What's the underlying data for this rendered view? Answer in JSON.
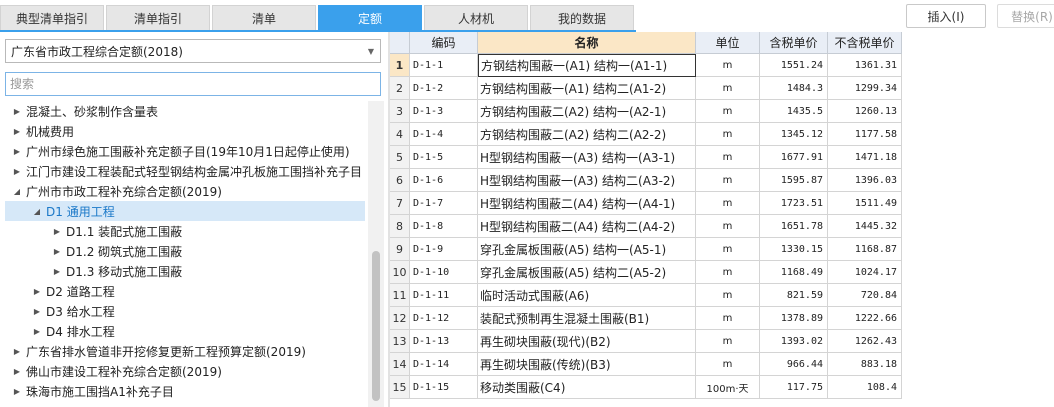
{
  "tabs": [
    {
      "label": "典型清单指引",
      "active": false
    },
    {
      "label": "清单指引",
      "active": false
    },
    {
      "label": "清单",
      "active": false
    },
    {
      "label": "定额",
      "active": true
    },
    {
      "label": "人材机",
      "active": false
    },
    {
      "label": "我的数据",
      "active": false
    }
  ],
  "buttons": {
    "insert": "插入(I)",
    "replace": "替换(R)"
  },
  "left": {
    "selected_library": "广东省市政工程综合定额(2018)",
    "search_placeholder": "搜索",
    "tree": [
      {
        "label": "混凝土、砂浆制作含量表",
        "level": 0,
        "expanded": false,
        "selected": false
      },
      {
        "label": "机械费用",
        "level": 0,
        "expanded": false,
        "selected": false
      },
      {
        "label": "广州市绿色施工围蔽补充定额子目(19年10月1日起停止使用)",
        "level": 0,
        "expanded": false,
        "selected": false
      },
      {
        "label": "江门市建设工程装配式轻型钢结构金属冲孔板施工围挡补充子目",
        "level": 0,
        "expanded": false,
        "selected": false
      },
      {
        "label": "广州市市政工程补充综合定额(2019)",
        "level": 0,
        "expanded": true,
        "selected": false
      },
      {
        "label": "D1 通用工程",
        "level": 1,
        "expanded": true,
        "selected": true
      },
      {
        "label": "D1.1 装配式施工围蔽",
        "level": 2,
        "expanded": false,
        "selected": false
      },
      {
        "label": "D1.2 砌筑式施工围蔽",
        "level": 2,
        "expanded": false,
        "selected": false
      },
      {
        "label": "D1.3 移动式施工围蔽",
        "level": 2,
        "expanded": false,
        "selected": false
      },
      {
        "label": "D2 道路工程",
        "level": 1,
        "expanded": false,
        "selected": false
      },
      {
        "label": "D3 给水工程",
        "level": 1,
        "expanded": false,
        "selected": false
      },
      {
        "label": "D4 排水工程",
        "level": 1,
        "expanded": false,
        "selected": false
      },
      {
        "label": "广东省排水管道非开挖修复更新工程预算定额(2019)",
        "level": 0,
        "expanded": false,
        "selected": false
      },
      {
        "label": "佛山市建设工程补充综合定额(2019)",
        "level": 0,
        "expanded": false,
        "selected": false
      },
      {
        "label": "珠海市施工围挡A1补充子目",
        "level": 0,
        "expanded": false,
        "selected": false
      }
    ]
  },
  "table": {
    "columns": [
      "",
      "编码",
      "名称",
      "单位",
      "含税单价",
      "不含税单价"
    ],
    "rows": [
      {
        "n": "1",
        "code": "D-1-1",
        "name": "方钢结构围蔽一(A1) 结构一(A1-1)",
        "unit": "m",
        "price_tax": "1551.24",
        "price_notax": "1361.31"
      },
      {
        "n": "2",
        "code": "D-1-2",
        "name": "方钢结构围蔽一(A1) 结构二(A1-2)",
        "unit": "m",
        "price_tax": "1484.3",
        "price_notax": "1299.34"
      },
      {
        "n": "3",
        "code": "D-1-3",
        "name": "方钢结构围蔽二(A2) 结构一(A2-1)",
        "unit": "m",
        "price_tax": "1435.5",
        "price_notax": "1260.13"
      },
      {
        "n": "4",
        "code": "D-1-4",
        "name": "方钢结构围蔽二(A2) 结构二(A2-2)",
        "unit": "m",
        "price_tax": "1345.12",
        "price_notax": "1177.58"
      },
      {
        "n": "5",
        "code": "D-1-5",
        "name": "H型钢结构围蔽一(A3) 结构一(A3-1)",
        "unit": "m",
        "price_tax": "1677.91",
        "price_notax": "1471.18"
      },
      {
        "n": "6",
        "code": "D-1-6",
        "name": "H型钢结构围蔽一(A3) 结构二(A3-2)",
        "unit": "m",
        "price_tax": "1595.87",
        "price_notax": "1396.03"
      },
      {
        "n": "7",
        "code": "D-1-7",
        "name": "H型钢结构围蔽二(A4) 结构一(A4-1)",
        "unit": "m",
        "price_tax": "1723.51",
        "price_notax": "1511.49"
      },
      {
        "n": "8",
        "code": "D-1-8",
        "name": "H型钢结构围蔽二(A4) 结构二(A4-2)",
        "unit": "m",
        "price_tax": "1651.78",
        "price_notax": "1445.32"
      },
      {
        "n": "9",
        "code": "D-1-9",
        "name": "穿孔金属板围蔽(A5) 结构一(A5-1)",
        "unit": "m",
        "price_tax": "1330.15",
        "price_notax": "1168.87"
      },
      {
        "n": "10",
        "code": "D-1-10",
        "name": "穿孔金属板围蔽(A5) 结构二(A5-2)",
        "unit": "m",
        "price_tax": "1168.49",
        "price_notax": "1024.17"
      },
      {
        "n": "11",
        "code": "D-1-11",
        "name": "临时活动式围蔽(A6)",
        "unit": "m",
        "price_tax": "821.59",
        "price_notax": "720.84"
      },
      {
        "n": "12",
        "code": "D-1-12",
        "name": "装配式预制再生混凝土围蔽(B1)",
        "unit": "m",
        "price_tax": "1378.89",
        "price_notax": "1222.66"
      },
      {
        "n": "13",
        "code": "D-1-13",
        "name": "再生砌块围蔽(现代)(B2)",
        "unit": "m",
        "price_tax": "1393.02",
        "price_notax": "1262.43"
      },
      {
        "n": "14",
        "code": "D-1-14",
        "name": "再生砌块围蔽(传统)(B3)",
        "unit": "m",
        "price_tax": "966.44",
        "price_notax": "883.18"
      },
      {
        "n": "15",
        "code": "D-1-15",
        "name": "移动类围蔽(C4)",
        "unit": "100m·天",
        "price_tax": "117.75",
        "price_notax": "108.4"
      }
    ]
  }
}
